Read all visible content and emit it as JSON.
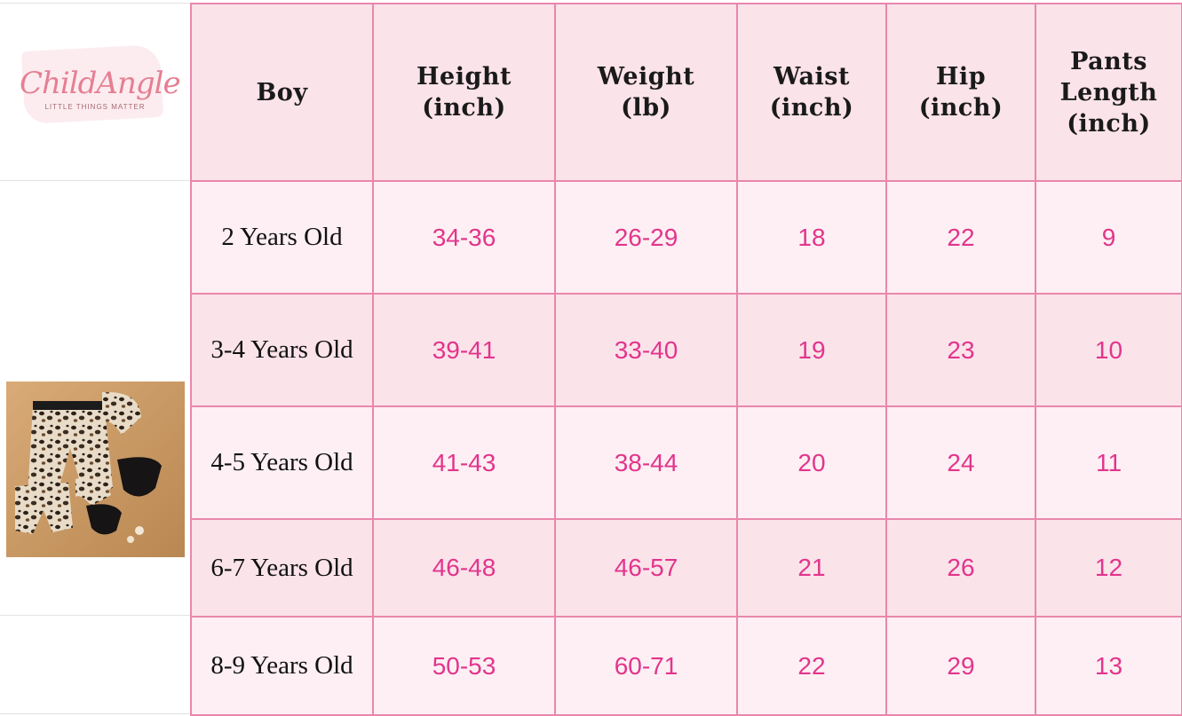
{
  "brand": {
    "name": "ChildAngle",
    "tagline": "LITTLE THINGS MATTER"
  },
  "photo": {
    "icon": "leopard-swimwear-photo"
  },
  "table": {
    "headers": [
      "Boy",
      "Height\n(inch)",
      "Weight\n(lb)",
      "Waist\n(inch)",
      "Hip\n(inch)",
      "Pants\nLength\n(inch)"
    ],
    "rows": [
      [
        "2 Years Old",
        "34-36",
        "26-29",
        "18",
        "22",
        "9"
      ],
      [
        "3-4 Years Old",
        "39-41",
        "33-40",
        "19",
        "23",
        "10"
      ],
      [
        "4-5 Years Old",
        "41-43",
        "38-44",
        "20",
        "24",
        "11"
      ],
      [
        "6-7 Years Old",
        "46-48",
        "46-57",
        "21",
        "26",
        "12"
      ],
      [
        "8-9 Years Old",
        "50-53",
        "60-71",
        "22",
        "29",
        "13"
      ]
    ]
  },
  "colors": {
    "header_bg": "#fbe3ea",
    "row_light": "#fdeff3",
    "row_dark": "#fbe3ea",
    "border": "#e987ac",
    "value_text": "#e2358c"
  }
}
